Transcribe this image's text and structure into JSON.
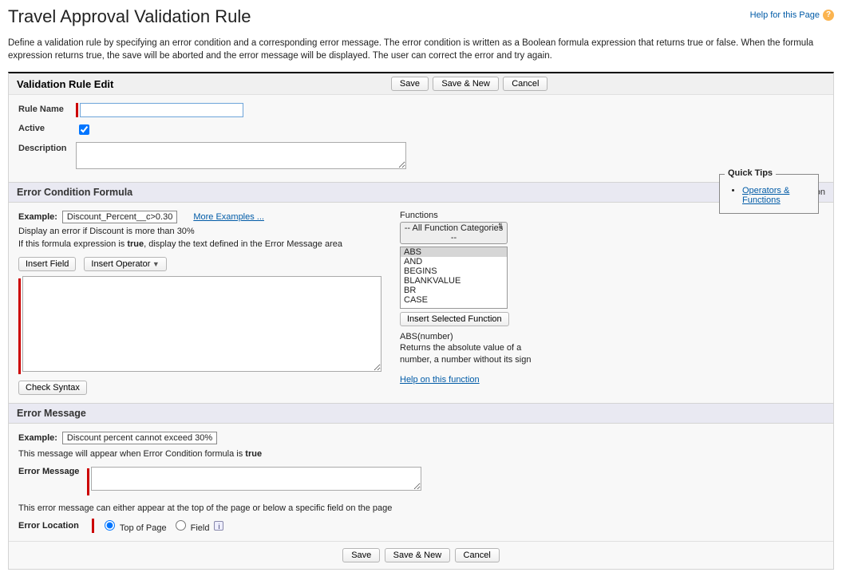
{
  "header": {
    "title": "Travel Approval Validation Rule",
    "help_link": "Help for this Page"
  },
  "description": "Define a validation rule by specifying an error condition and a corresponding error message. The error condition is written as a Boolean formula expression that returns true or false. When the formula expression returns true, the save will be aborted and the error message will be displayed. The user can correct the error and try again.",
  "panel": {
    "title": "Validation Rule Edit",
    "buttons": {
      "save": "Save",
      "save_new": "Save & New",
      "cancel": "Cancel"
    }
  },
  "fields": {
    "rule_name_label": "Rule Name",
    "rule_name_value": "",
    "active_label": "Active",
    "active_checked": true,
    "description_label": "Description",
    "description_value": ""
  },
  "quick_tips": {
    "title": "Quick Tips",
    "link": "Operators & Functions"
  },
  "formula_section": {
    "title": "Error Condition Formula",
    "required_info": "= Required Information",
    "example_label": "Example:",
    "example_value": "Discount_Percent__c>0.30",
    "more_examples": "More Examples ...",
    "example_hint": "Display an error if Discount is more than 30%",
    "true_hint_prefix": "If this formula expression is ",
    "true_word": "true",
    "true_hint_suffix": ", display the text defined in the Error Message area",
    "insert_field": "Insert Field",
    "insert_operator": "Insert Operator",
    "formula_value": "",
    "check_syntax": "Check Syntax",
    "functions_label": "Functions",
    "functions_category": "-- All Function Categories --",
    "functions": [
      "ABS",
      "AND",
      "BEGINS",
      "BLANKVALUE",
      "BR",
      "CASE"
    ],
    "insert_selected": "Insert Selected Function",
    "func_sig": "ABS(number)",
    "func_desc": "Returns the absolute value of a number, a number without its sign",
    "func_help": "Help on this function"
  },
  "error_section": {
    "title": "Error Message",
    "example_label": "Example:",
    "example_value": "Discount percent cannot exceed 30%",
    "appear_hint_prefix": "This message will appear when Error Condition formula is ",
    "appear_hint_true": "true",
    "error_message_label": "Error Message",
    "error_message_value": "",
    "appear_where": "This error message can either appear at the top of the page or below a specific field on the page",
    "error_location_label": "Error Location",
    "top_of_page": "Top of Page",
    "field": "Field"
  }
}
